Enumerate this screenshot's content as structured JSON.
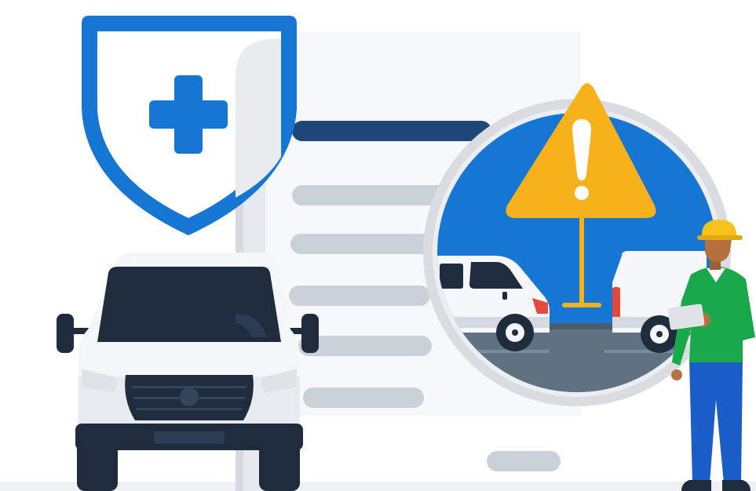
{
  "scene": {
    "type": "illustration",
    "subject": "",
    "icons": [
      "shield-plus-icon",
      "document-icon",
      "warning-icon",
      "van-icon",
      "worker-icon"
    ]
  },
  "palette": {
    "primary_blue": "#1576d4",
    "navy_line": "#1e4777",
    "doc_gray": "#dde1e6",
    "line_gray": "#cbd1d8",
    "warning_yellow": "#f7b21b",
    "van_body": "#f5f6f8",
    "van_dark": "#1f2c3d",
    "road_gray": "#5f7282",
    "worker_shirt": "#19a84a",
    "worker_pants": "#1a5dc8",
    "helmet_yellow": "#f8c21c"
  }
}
